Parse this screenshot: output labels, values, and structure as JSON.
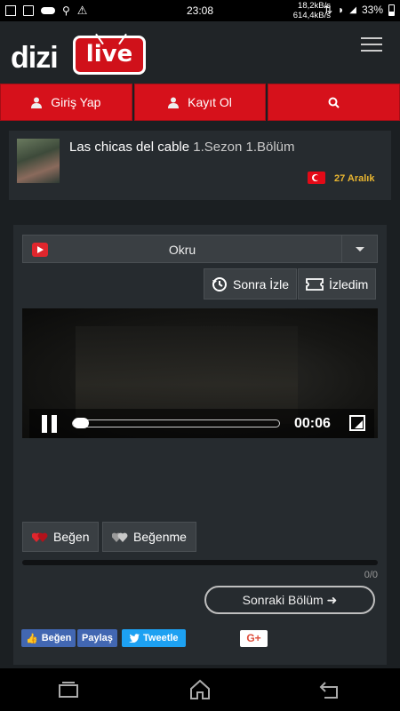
{
  "status_bar": {
    "time": "23:08",
    "net_up": "18,2kB/s",
    "net_down": "614,4kB/s",
    "battery": "33%"
  },
  "header": {
    "logo_left": "dizi",
    "logo_right": "live"
  },
  "nav": {
    "login": "Giriş Yap",
    "register": "Kayıt Ol"
  },
  "episode": {
    "show_title": "Las chicas del cable",
    "episode_info": "1.Sezon 1.Bölüm",
    "date": "27 Aralık"
  },
  "player": {
    "source": "Okru",
    "watch_later": "Sonra İzle",
    "watched": "İzledim",
    "time": "00:06",
    "progress_fraction": 0.04
  },
  "actions": {
    "like": "Beğen",
    "dislike": "Beğenme",
    "counter": "0/0",
    "next_episode": "Sonraki Bölüm ➜"
  },
  "social": {
    "fb_like": "Beğen",
    "fb_share": "Paylaş",
    "tweet": "Tweetle",
    "gplus": "G+"
  },
  "colors": {
    "brand_red": "#d6111b",
    "background": "#1b1f22",
    "panel": "#262b2f",
    "date_yellow": "#e8b530",
    "facebook": "#4267b2",
    "twitter": "#1da1f2"
  }
}
